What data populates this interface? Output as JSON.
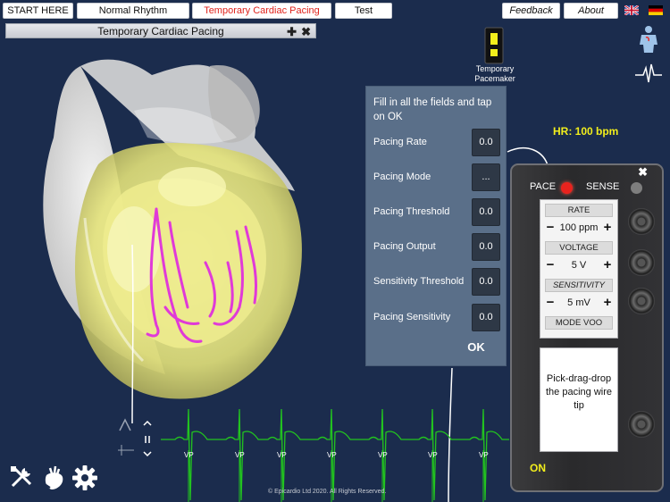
{
  "nav": {
    "tabs": [
      "START HERE",
      "Normal Rhythm",
      "Temporary Cardiac Pacing",
      "Test"
    ],
    "active_tab": "Temporary Cardiac Pacing",
    "feedback_label": "Feedback",
    "about_label": "About"
  },
  "panel": {
    "title": "Temporary Cardiac Pacing",
    "expand_label": "✚",
    "close_label": "✖"
  },
  "side": {
    "pacemaker_label": "Temporary Pacemaker"
  },
  "form": {
    "intro": "Fill in all the fields and tap on OK",
    "fields": [
      {
        "label": "Pacing Rate",
        "value": "0.0"
      },
      {
        "label": "Pacing Mode",
        "value": "..."
      },
      {
        "label": "Pacing Threshold",
        "value": "0.0"
      },
      {
        "label": "Pacing Output",
        "value": "0.0"
      },
      {
        "label": "Sensitivity Threshold",
        "value": "0.0"
      },
      {
        "label": "Pacing Sensitivity",
        "value": "0.0"
      }
    ],
    "ok_label": "OK"
  },
  "hr": {
    "text": "HR: 100 bpm"
  },
  "device": {
    "close_label": "✖",
    "pace_label": "PACE",
    "sense_label": "SENSE",
    "rate_label": "RATE",
    "rate_value": "100 ppm",
    "voltage_label": "VOLTAGE",
    "voltage_value": "5 V",
    "sensitivity_label": "SENSITIVITY",
    "sensitivity_value": "5 mV",
    "mode_label": "MODE VOO",
    "message": "Pick-drag-drop the pacing wire tip",
    "on_label": "ON",
    "minus": "−",
    "plus": "+"
  },
  "ecg": {
    "beat_label": "VP",
    "beat_count": 7
  },
  "footer": {
    "copyright": "© Epicardio Ltd 2020. All Rights Reserved."
  },
  "colors": {
    "background": "#1b2c4d",
    "ecg_trace": "#22c41f",
    "pace_led": "#e8231e",
    "sense_led": "#7e7e7e",
    "accent_yellow": "#f2ee1c",
    "active_tab_text": "#e0241d"
  }
}
